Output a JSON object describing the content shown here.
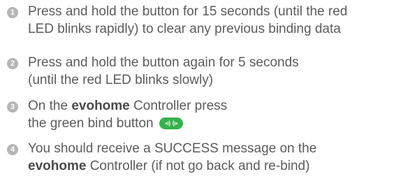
{
  "steps": [
    {
      "number": "1",
      "lines": [
        "Press and hold the button for 15 seconds (until the red",
        "LED blinks rapidly) to clear any previous binding data"
      ]
    },
    {
      "number": "2",
      "lines": [
        "Press and hold the button again for 5 seconds",
        "(until the red LED blinks slowly)"
      ]
    },
    {
      "number": "3",
      "line1_prefix": "On the ",
      "brand": "evohome",
      "line1_suffix": " Controller press",
      "line2": "the green bind button "
    },
    {
      "number": "4",
      "line1": "You should receive a SUCCESS message on the",
      "brand": "evohome",
      "line2_suffix": " Controller (if not go back and re-bind)"
    }
  ],
  "colors": {
    "text": "#5c5c5c",
    "number_badge": "#b5b5b5",
    "bind_button": "#36b24a"
  },
  "icons": {
    "bind_button": "bind-button-icon"
  }
}
